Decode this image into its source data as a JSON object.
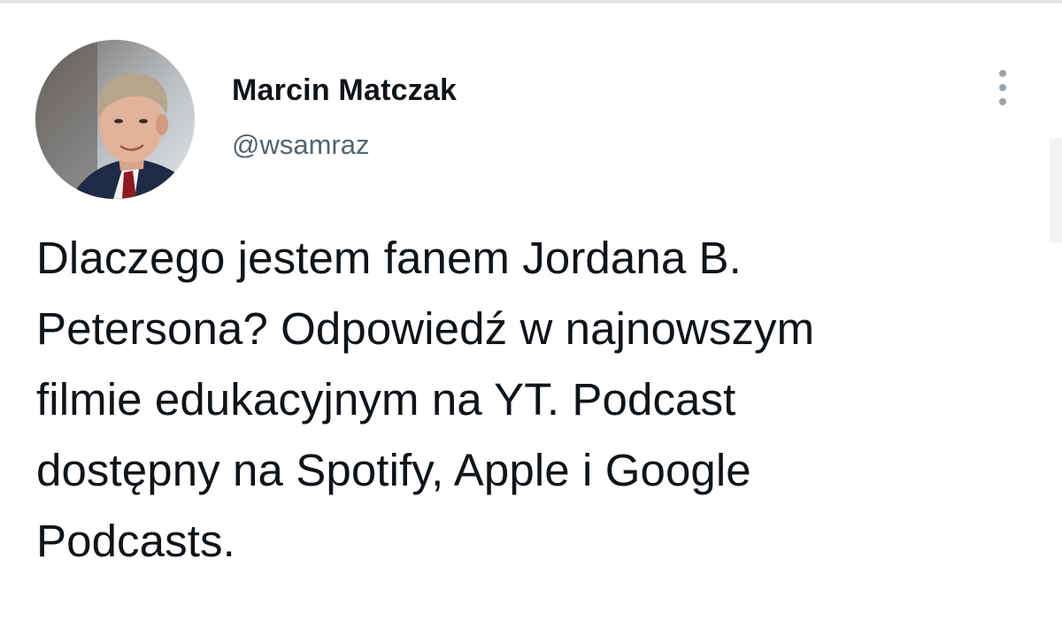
{
  "tweet": {
    "author": {
      "display_name": "Marcin Matczak",
      "handle": "@wsamraz",
      "avatar_icon": "user-photo-avatar"
    },
    "more_icon": "more-vertical-icon",
    "text": "Dlaczego jestem fanem Jordana B.\nPetersona? Odpowiedź w najnowszym\nfilmie edukacyjnym na YT. Podcast\ndostępny na Spotify, Apple i Google\nPodcasts."
  },
  "colors": {
    "text_primary": "#0f1419",
    "text_secondary": "#536471",
    "icon_gray": "#99a3ad",
    "background": "#ffffff"
  }
}
